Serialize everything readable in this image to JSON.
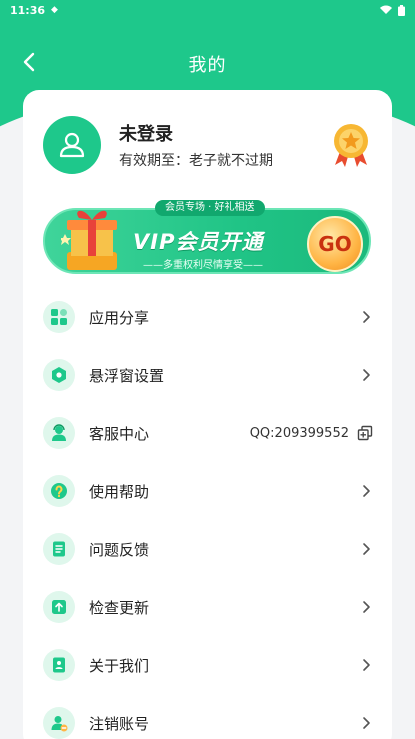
{
  "status_bar": {
    "time": "11:36"
  },
  "header": {
    "title": "我的"
  },
  "profile": {
    "name": "未登录",
    "expire": "有效期至：老子就不过期"
  },
  "vip": {
    "tag": "会员专场 · 好礼相送",
    "title": "VIP会员开通",
    "subtitle": "——多重权利尽情享受——",
    "go_label": "GO"
  },
  "menu": [
    {
      "label": "应用分享",
      "icon": "share-icon"
    },
    {
      "label": "悬浮窗设置",
      "icon": "float-window-icon"
    },
    {
      "label": "客服中心",
      "icon": "customer-service-icon",
      "value": "QQ:209399552"
    },
    {
      "label": "使用帮助",
      "icon": "help-icon"
    },
    {
      "label": "问题反馈",
      "icon": "feedback-icon"
    },
    {
      "label": "检查更新",
      "icon": "update-icon"
    },
    {
      "label": "关于我们",
      "icon": "about-icon"
    },
    {
      "label": "注销账号",
      "icon": "cancel-account-icon"
    }
  ],
  "colors": {
    "brand": "#1ec88b",
    "icon_bg": "#dff7ec"
  }
}
